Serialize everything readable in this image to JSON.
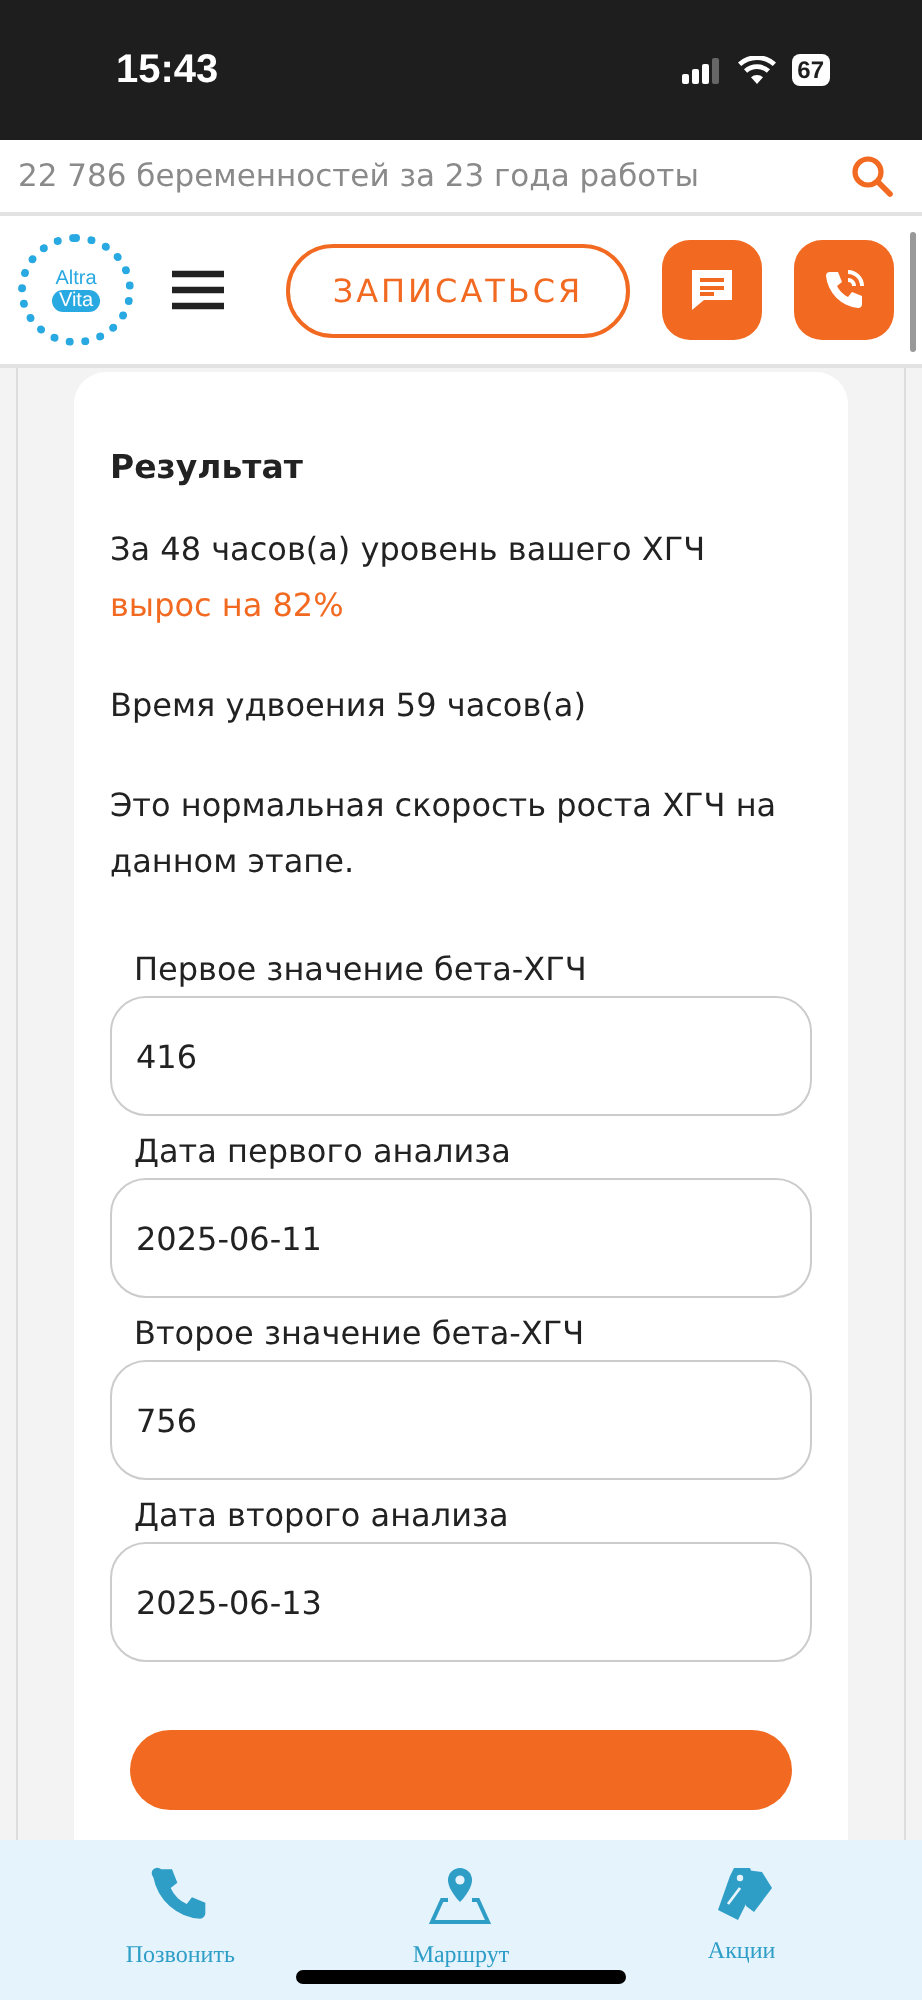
{
  "status_bar": {
    "time": "15:43",
    "battery": "67"
  },
  "search": {
    "placeholder": "22 786 беременностей за 23 года работы"
  },
  "header": {
    "logo": [
      "Altra",
      "Vita"
    ],
    "cta": "ЗАПИСАТЬСЯ"
  },
  "result": {
    "title": "Результат",
    "summary": "За 48 часов(а) уровень вашего ХГЧ **вырос на 82%**",
    "doubling": "Время удвоения 59 часов(а)",
    "verdict": "Это нормальная скорость роста ХГЧ на данном этапе."
  },
  "fields": [
    {
      "label": "Первое значение бета-ХГЧ",
      "value": "416"
    },
    {
      "label": "Дата первого анализа",
      "value": "2025-06-11"
    },
    {
      "label": "Второе значение бета-ХГЧ",
      "value": "756"
    },
    {
      "label": "Дата второго анализа",
      "value": "2025-06-13"
    }
  ],
  "bottom_nav": [
    {
      "kind": "phone",
      "label": "Позвонить"
    },
    {
      "kind": "route",
      "label": "Маршрут"
    },
    {
      "kind": "tags",
      "label": "Акции"
    }
  ]
}
